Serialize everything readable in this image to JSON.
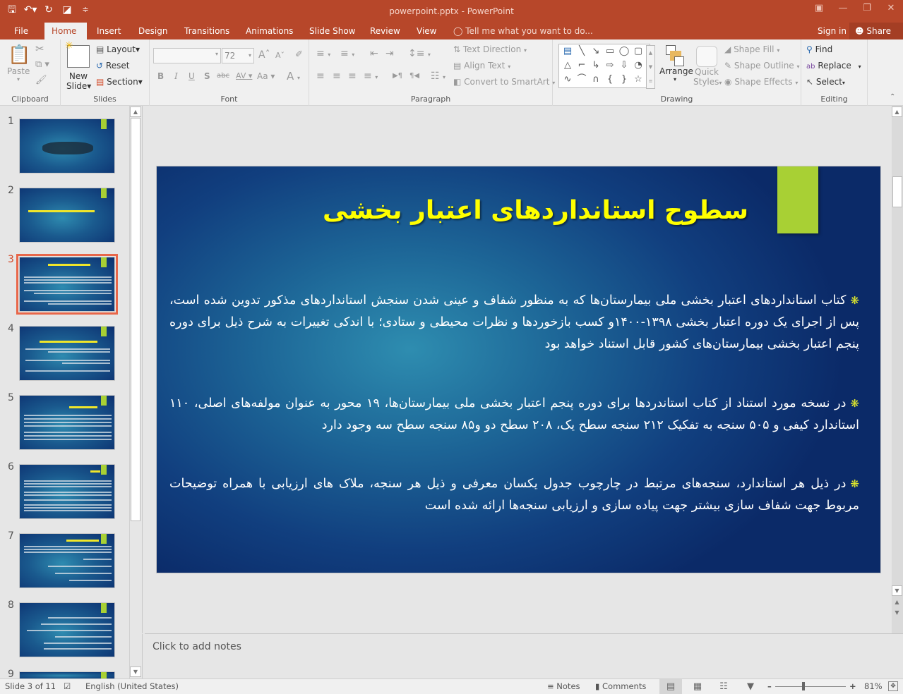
{
  "app": {
    "window_title": "powerpoint.pptx - PowerPoint",
    "qat": [
      {
        "icon": "save-icon",
        "glyph": "🖫"
      },
      {
        "icon": "undo-icon",
        "glyph": "↶"
      },
      {
        "icon": "redo-icon",
        "glyph": "↻"
      },
      {
        "icon": "start-from-beginning-icon",
        "glyph": "⎚"
      },
      {
        "icon": "customize-qat-icon",
        "glyph": "≑"
      }
    ],
    "window_controls": [
      {
        "icon": "ribbon-display-options-icon",
        "glyph": "⊡"
      },
      {
        "icon": "minimize-icon",
        "glyph": "—"
      },
      {
        "icon": "restore-icon",
        "glyph": "❐"
      },
      {
        "icon": "close-icon",
        "glyph": "✕"
      }
    ]
  },
  "tabs": [
    {
      "label": "File",
      "active": false
    },
    {
      "label": "Home",
      "active": true
    },
    {
      "label": "Insert",
      "active": false
    },
    {
      "label": "Design",
      "active": false
    },
    {
      "label": "Transitions",
      "active": false
    },
    {
      "label": "Animations",
      "active": false
    },
    {
      "label": "Slide Show",
      "active": false
    },
    {
      "label": "Review",
      "active": false
    },
    {
      "label": "View",
      "active": false
    }
  ],
  "tell_me": "Tell me what you want to do...",
  "sign_in": "Sign in",
  "share": "Share",
  "ribbon": {
    "clipboard": {
      "label": "Clipboard",
      "paste": "Paste"
    },
    "slides": {
      "label": "Slides",
      "new_slide": "New",
      "new_slide2": "Slide",
      "layout": "Layout",
      "reset": "Reset",
      "section": "Section"
    },
    "font": {
      "label": "Font",
      "font_name": "",
      "font_size": "72",
      "bold": "B",
      "italic": "I",
      "underline": "U",
      "shadow": "S",
      "strike": "abc",
      "spacing": "AV",
      "case": "Aa",
      "color": "A"
    },
    "paragraph": {
      "label": "Paragraph",
      "text_direction": "Text Direction",
      "align_text": "Align Text",
      "convert_smartart": "Convert to SmartArt"
    },
    "drawing": {
      "label": "Drawing",
      "arrange": "Arrange",
      "quick_styles": "Quick",
      "quick_styles2": "Styles",
      "shape_fill": "Shape Fill",
      "shape_outline": "Shape Outline",
      "shape_effects": "Shape Effects",
      "shapes": [
        "▤",
        "╲",
        "↘",
        "▭",
        "◯",
        "▢",
        "△",
        "⌐",
        "↳",
        "⇨",
        "⇩",
        "◔",
        "∿",
        "⌒",
        "∩",
        "{",
        "}",
        "☆"
      ]
    },
    "editing": {
      "label": "Editing",
      "find": "Find",
      "replace": "Replace",
      "select": "Select"
    }
  },
  "thumbnails": [
    {
      "num": "1",
      "active": false
    },
    {
      "num": "2",
      "active": false
    },
    {
      "num": "3",
      "active": true
    },
    {
      "num": "4",
      "active": false
    },
    {
      "num": "5",
      "active": false
    },
    {
      "num": "6",
      "active": false
    },
    {
      "num": "7",
      "active": false
    },
    {
      "num": "8",
      "active": false
    },
    {
      "num": "9",
      "active": false
    }
  ],
  "slide": {
    "title": "سطوح استانداردهای اعتبار بخشی",
    "bullet_glyph": "❋",
    "paragraphs": [
      "کتاب استانداردهای اعتبار بخشی ملی بیمارستان‌ها که به منظور شفاف و عینی شدن سنجش استانداردهای مذکور تدوین شده است، پس از اجرای یک دوره اعتبار بخشی ۱۳۹۸-۱۴۰۰و کسب بازخوردها و نظرات محیطی و ستادی؛ با اندکی تغییرات به شرح ذیل برای دوره پنجم اعتبار بخشی بیمارستان‌های کشور قابل استناد خواهد بود",
      "در نسخه مورد استناد از کتاب استاندردها برای دوره پنجم اعتبار بخشی ملی بیمارستان‌ها، ۱۹ محور به عنوان مولفه‌های اصلی، ۱۱۰ استاندارد کیفی و ۵۰۵ سنجه به تفکیک ۲۱۲ سنجه سطح یک، ۲۰۸ سطح دو و۸۵ سنجه سطح سه وجود دارد",
      "در ذیل هر استاندارد، سنجه‌های مرتبط در چارچوب جدول یکسان معرفی و ذیل هر سنجه، ملاک های ارزیابی با همراه توضیحات مربوط جهت شفاف سازی بیشتر جهت پیاده سازی و ارزیابی سنجه‌ها ارائه شده است"
    ]
  },
  "notes_placeholder": "Click to add notes",
  "status": {
    "slide_info": "Slide 3 of 11",
    "language": "English (United States)",
    "notes": "Notes",
    "comments": "Comments",
    "zoom": "81%"
  }
}
